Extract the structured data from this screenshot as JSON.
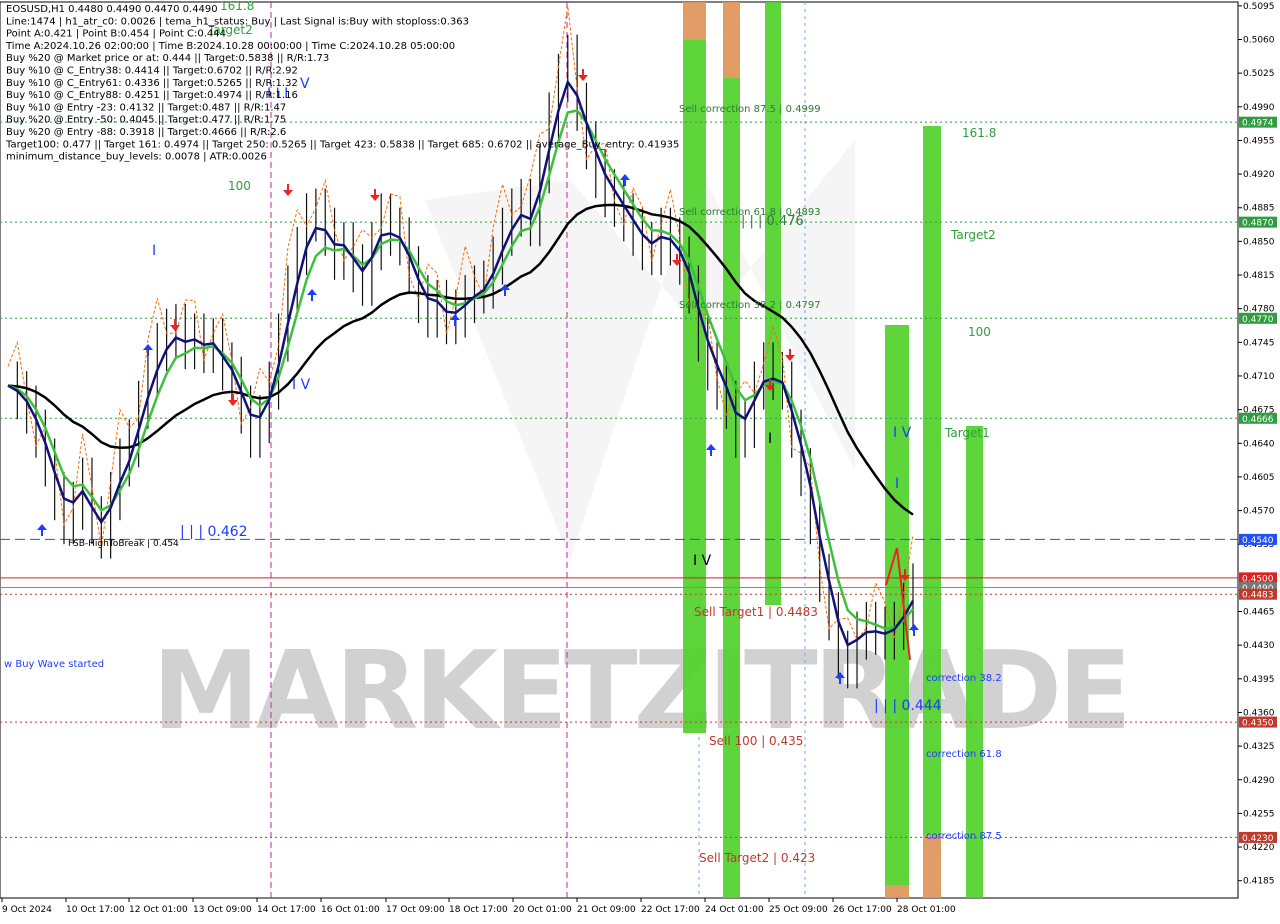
{
  "info_lines": [
    "EOSUSD,H1  0.4480 0.4490 0.4470 0.4490",
    "Line:1474 | h1_atr_c0: 0.0026 | tema_h1_status: Buy | Last Signal is:Buy with stoploss:0.363",
    "Point A:0.421 | Point B:0.454 | Point C:0.444",
    "Time A:2024.10.26 02:00:00 | Time B:2024.10.28 00:00:00 | Time C:2024.10.28 05:00:00",
    "Buy %20 @ Market price or at: 0.444 || Target:0.5838 || R/R:1.73",
    "Buy %10 @ C_Entry38: 0.4414 || Target:0.6702 || R/R:2.92",
    "Buy %10 @ C_Entry61: 0.4336 || Target:0.5265 || R/R:1.32",
    "Buy %10 @ C_Entry88: 0.4251 || Target:0.4974 || R/R:1.16",
    "Buy %10 @ Entry -23: 0.4132 || Target:0.487 || R/R:1.47",
    "Buy %20 @ Entry -50: 0.4045 || Target:0.477 || R/R:1.75",
    "Buy %20 @ Entry -88: 0.3918 || Target:0.4666 || R/R:2.6",
    "Target100: 0.477 || Target 161: 0.4974 || Target 250: 0.5265 || Target 423: 0.5838 || Target 685: 0.6702 || average_Buy_entry: 0.41935",
    "minimum_distance_buy_levels: 0.0078 | ATR:0.0026"
  ],
  "chart_data": {
    "type": "line",
    "symbol": "EOSUSD,H1",
    "ylim": [
      0.4167,
      0.5099
    ],
    "y_ticks": [
      0.5095,
      0.506,
      0.5025,
      0.499,
      0.4955,
      0.492,
      0.4885,
      0.485,
      0.4815,
      0.478,
      0.4745,
      0.471,
      0.4675,
      0.464,
      0.4605,
      0.457,
      0.4535,
      0.4465,
      0.443,
      0.4395,
      0.436,
      0.4325,
      0.429,
      0.4255,
      0.422,
      0.4185
    ],
    "x_labels": [
      "9 Oct 2024",
      "10 Oct 17:00",
      "12 Oct 01:00",
      "13 Oct 09:00",
      "14 Oct 17:00",
      "16 Oct 01:00",
      "17 Oct 09:00",
      "18 Oct 17:00",
      "20 Oct 01:00",
      "21 Oct 09:00",
      "22 Oct 17:00",
      "24 Oct 01:00",
      "25 Oct 09:00",
      "26 Oct 17:00",
      "28 Oct 01:00"
    ],
    "price_tags": [
      {
        "value": "0.4974",
        "color": "#2e9e3e"
      },
      {
        "value": "0.4870",
        "color": "#2e9e3e"
      },
      {
        "value": "0.4770",
        "color": "#2e9e3e"
      },
      {
        "value": "0.4666",
        "color": "#2e9e3e"
      },
      {
        "value": "0.4540",
        "color": "#1e50ff"
      },
      {
        "value": "0.4500",
        "color": "#dd2222"
      },
      {
        "value": "0.4490",
        "color": "#777777"
      },
      {
        "value": "0.4483",
        "color": "#c0392b"
      },
      {
        "value": "0.4350",
        "color": "#c0392b"
      },
      {
        "value": "0.4230",
        "color": "#c0392b"
      }
    ],
    "horizontal_levels": [
      {
        "value": 0.4974,
        "color": "#2e9e3e",
        "style": "dotted"
      },
      {
        "value": 0.487,
        "color": "#2e9e3e",
        "style": "dotted"
      },
      {
        "value": 0.477,
        "color": "#2e9e3e",
        "style": "dotted"
      },
      {
        "value": 0.4666,
        "color": "#2e9e3e",
        "style": "dotted"
      },
      {
        "value": 0.454,
        "color": "#1e50ff",
        "style": "dashed"
      },
      {
        "value": 0.45,
        "color": "#dd2222",
        "style": "solid"
      },
      {
        "value": 0.449,
        "color": "#888888",
        "style": "solid"
      },
      {
        "value": 0.4483,
        "color": "#c0392b",
        "style": "dotted"
      },
      {
        "value": 0.435,
        "color": "#c0392b",
        "style": "dotted"
      },
      {
        "value": 0.423,
        "color": "#c0392b",
        "style": "dotted"
      }
    ],
    "annotations": [
      {
        "text": "161.8",
        "color": "#2e9e3e"
      },
      {
        "text": "Target2",
        "color": "#2e9e3e"
      },
      {
        "text": "100",
        "color": "#2e9e3e"
      },
      {
        "text": "Target1",
        "color": "#2e9e3e"
      },
      {
        "text": "Sell correction 87.5 | 0.4999",
        "color": "#2e7d32"
      },
      {
        "text": "Sell correction 61.8 | 0.4893",
        "color": "#2e7d32"
      },
      {
        "text": "Sell correction 38.2 | 0.4797",
        "color": "#2e7d32"
      },
      {
        "text": "| | | 0.476",
        "color": "#2e7d32"
      },
      {
        "text": "Sell Target1 | 0.4483",
        "color": "#c0392b"
      },
      {
        "text": "Sell 100 | 0.435",
        "color": "#c0392b"
      },
      {
        "text": "Sell Target2 | 0.423",
        "color": "#c0392b"
      },
      {
        "text": "correction 38.2",
        "color": "#1e3cff"
      },
      {
        "text": "correction 61.8",
        "color": "#1e3cff"
      },
      {
        "text": "correction 87.5",
        "color": "#1e3cff"
      },
      {
        "text": "| | | 0.462",
        "color": "#1e3cff"
      },
      {
        "text": "FSB-HighToBreak | 0.454",
        "color": "#000000"
      },
      {
        "text": "| | | 0.444",
        "color": "#1e3cff"
      },
      {
        "text": "w Buy Wave started",
        "color": "#1e3cff"
      },
      {
        "text": "I V",
        "color": "#1e3cff"
      },
      {
        "text": "I I I",
        "color": "#1e3cff"
      },
      {
        "text": "I",
        "color": "#1e3cff"
      },
      {
        "text": "I V",
        "color": "#1e3cff"
      },
      {
        "text": "V",
        "color": "#1e3cff"
      },
      {
        "text": "I",
        "color": "#1e3cff"
      },
      {
        "text": "I V",
        "color": "#000000"
      },
      {
        "text": "I",
        "color": "#000000"
      }
    ],
    "watermark": "MARKETZITRADE"
  }
}
